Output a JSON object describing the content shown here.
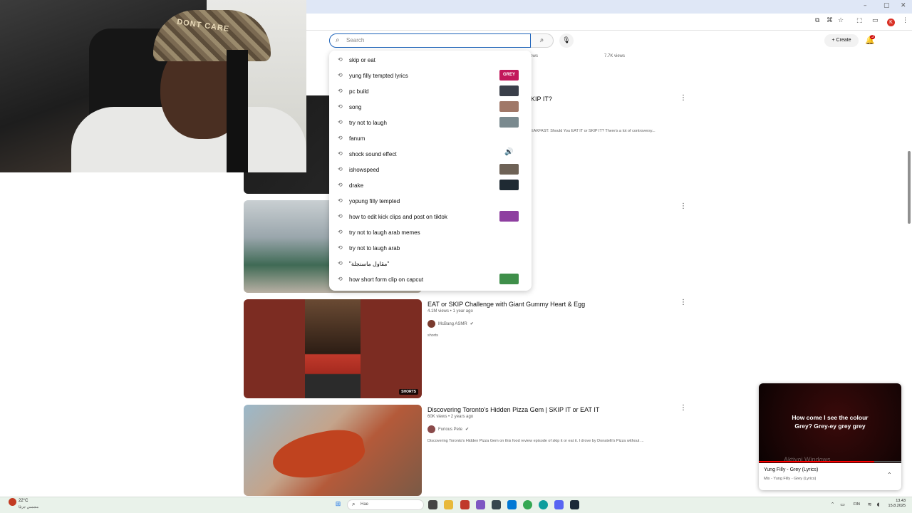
{
  "browser": {
    "minimize_glyph": "–",
    "maximize_glyph": "▢",
    "close_glyph": "✕",
    "profile_letter": "K"
  },
  "header": {
    "search_placeholder": "Search",
    "create_label": "+ Create",
    "notification_count": "3"
  },
  "webcam": {
    "cap_text": "DONT CARE"
  },
  "suggestions": [
    {
      "text": "skip or eat",
      "thumb": null
    },
    {
      "text": "yung filly tempted lyrics",
      "thumb": "#c2185b",
      "thumb_label": "GREY"
    },
    {
      "text": "pc build",
      "thumb": "#3a3f4a"
    },
    {
      "text": "song",
      "thumb": "#a07868"
    },
    {
      "text": "try not to laugh",
      "thumb": "#7a8a8f"
    },
    {
      "text": "fanum",
      "thumb": null
    },
    {
      "text": "shock sound effect",
      "thumb": null,
      "speaker": true
    },
    {
      "text": "ishowspeed",
      "thumb": "#6e6256"
    },
    {
      "text": "drake",
      "thumb": "#1f2a33"
    },
    {
      "text": "yopung filly tempted",
      "thumb": null
    },
    {
      "text": "how to edit kick clips and post on tiktok",
      "thumb": "#8e3fa0"
    },
    {
      "text": "try not to laugh arab memes",
      "thumb": null
    },
    {
      "text": "try not to laugh arab",
      "thumb": null
    },
    {
      "text": "\"مقاول ماسنجلة\"",
      "thumb": null
    },
    {
      "text": "how short form clip on capcut",
      "thumb": "#3f8f4a"
    }
  ],
  "feed_partial": {
    "views_top": "7.7K views",
    "views_left": "views",
    "skip_title_fragment": "KIP IT?",
    "desc_fragment": "EAKFAST: Should You EAT IT or SKIP IT? There's a lot of controversy..."
  },
  "videos": [
    {
      "title": "EAT or SKIP Challenge with Giant Gummy Heart & Egg",
      "meta": "4.1M views • 1 year ago",
      "channel": "McBang ASMR",
      "desc": "shorts",
      "shorts_badge": "SHORTS"
    },
    {
      "title": "Discovering Toronto's Hidden Pizza Gem | SKIP IT or EAT IT",
      "meta": "60K views • 2 years ago",
      "channel": "Furious Pete",
      "desc": "Discovering Toronto's Hidden Pizza Gem on this food review episode of skip it or eat it. I drove by Donatelli's Pizza without ..."
    }
  ],
  "miniplayer": {
    "lyric_line1": "How come I see the colour",
    "lyric_line2": "Grey? Grey-ey grey grey",
    "watermark": "Aktivoi Windows",
    "title": "Yung Filly - Grey (Lyrics)",
    "subtitle": "Mix - Yung Filly - Grey (Lyrics)",
    "progress": 0.81
  },
  "taskbar": {
    "weather_temp": "22°C",
    "weather_desc": "مشمس جزئيًا",
    "search_text": "Hae",
    "lang": "FIN",
    "time": "13.43",
    "date": "15.8.2025"
  },
  "colors": {
    "accent": "#1c62b9",
    "youtube_red": "#ff0000",
    "taskbar_bg": "#e9f2ea"
  }
}
